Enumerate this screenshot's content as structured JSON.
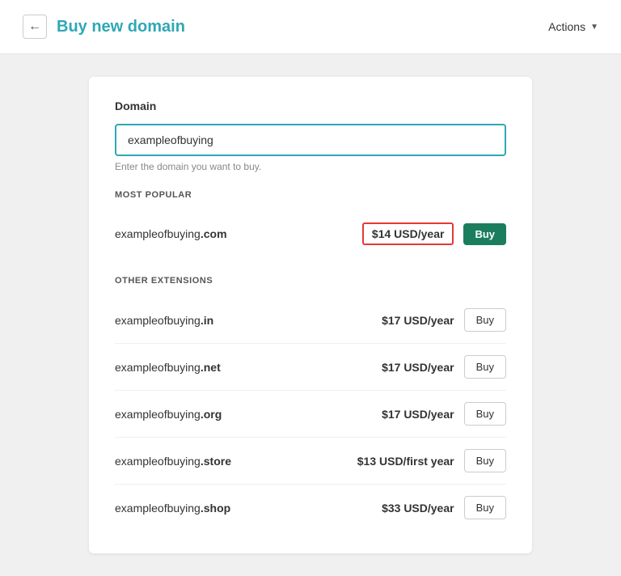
{
  "topbar": {
    "back_icon": "←",
    "title": "Buy new domain",
    "actions_label": "Actions",
    "actions_chevron": "▼"
  },
  "card": {
    "domain_section_label": "Domain",
    "domain_input_value": "exampleofbuying",
    "domain_input_placeholder": "Enter the domain you want to buy.",
    "domain_hint": "Enter the domain you want to buy.",
    "most_popular_label": "MOST POPULAR",
    "popular_domains": [
      {
        "name": "exampleofbuying",
        "ext": ".com",
        "price": "$14 USD/year",
        "highlighted": true,
        "buy_label": "Buy",
        "primary": true
      }
    ],
    "other_extensions_label": "OTHER EXTENSIONS",
    "other_domains": [
      {
        "name": "exampleofbuying",
        "ext": ".in",
        "price": "$17 USD/year",
        "buy_label": "Buy"
      },
      {
        "name": "exampleofbuying",
        "ext": ".net",
        "price": "$17 USD/year",
        "buy_label": "Buy"
      },
      {
        "name": "exampleofbuying",
        "ext": ".org",
        "price": "$17 USD/year",
        "buy_label": "Buy"
      },
      {
        "name": "exampleofbuying",
        "ext": ".store",
        "price": "$13 USD/first year",
        "buy_label": "Buy"
      },
      {
        "name": "exampleofbuying",
        "ext": ".shop",
        "price": "$33 USD/year",
        "buy_label": "Buy"
      }
    ]
  }
}
